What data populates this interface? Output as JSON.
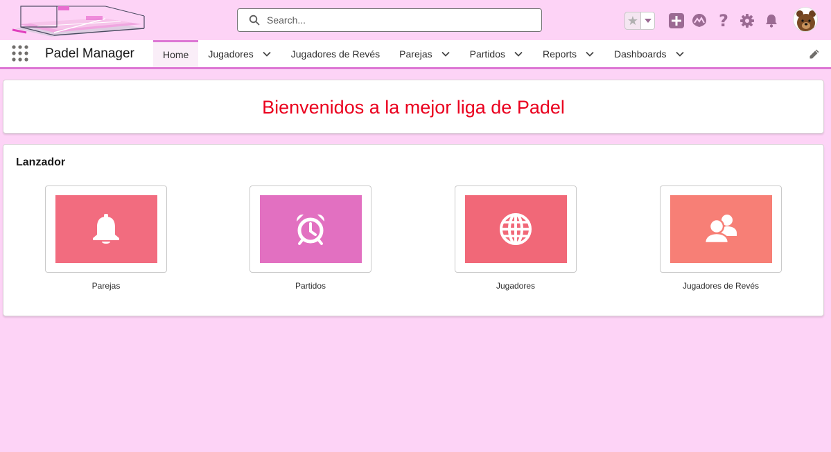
{
  "header": {
    "search_placeholder": "Search...",
    "icons": [
      "search-icon",
      "star-icon",
      "chevron-down-icon",
      "add-icon",
      "trailhead-icon",
      "help-icon",
      "gear-icon",
      "bell-icon",
      "avatar-bear"
    ]
  },
  "nav": {
    "app_name": "Padel Manager",
    "tabs": [
      {
        "label": "Home",
        "active": true,
        "has_menu": false
      },
      {
        "label": "Jugadores",
        "active": false,
        "has_menu": true
      },
      {
        "label": "Jugadores de Revés",
        "active": false,
        "has_menu": false
      },
      {
        "label": "Parejas",
        "active": false,
        "has_menu": true
      },
      {
        "label": "Partidos",
        "active": false,
        "has_menu": true
      },
      {
        "label": "Reports",
        "active": false,
        "has_menu": true
      },
      {
        "label": "Dashboards",
        "active": false,
        "has_menu": true
      }
    ]
  },
  "welcome": {
    "text": "Bienvenidos a la mejor liga de Padel",
    "color": "#ea001e"
  },
  "launcher": {
    "title": "Lanzador",
    "items": [
      {
        "label": "Parejas",
        "icon": "bell-icon",
        "color": "#f26c7f"
      },
      {
        "label": "Partidos",
        "icon": "alarm-clock-icon",
        "color": "#e270c1"
      },
      {
        "label": "Jugadores",
        "icon": "globe-icon",
        "color": "#f16878"
      },
      {
        "label": "Jugadores de Revés",
        "icon": "users-icon",
        "color": "#f77f76"
      }
    ]
  },
  "colors": {
    "page_background": "#fdd3f6",
    "accent": "#dd77d4",
    "header_icon": "#9b6a93"
  }
}
